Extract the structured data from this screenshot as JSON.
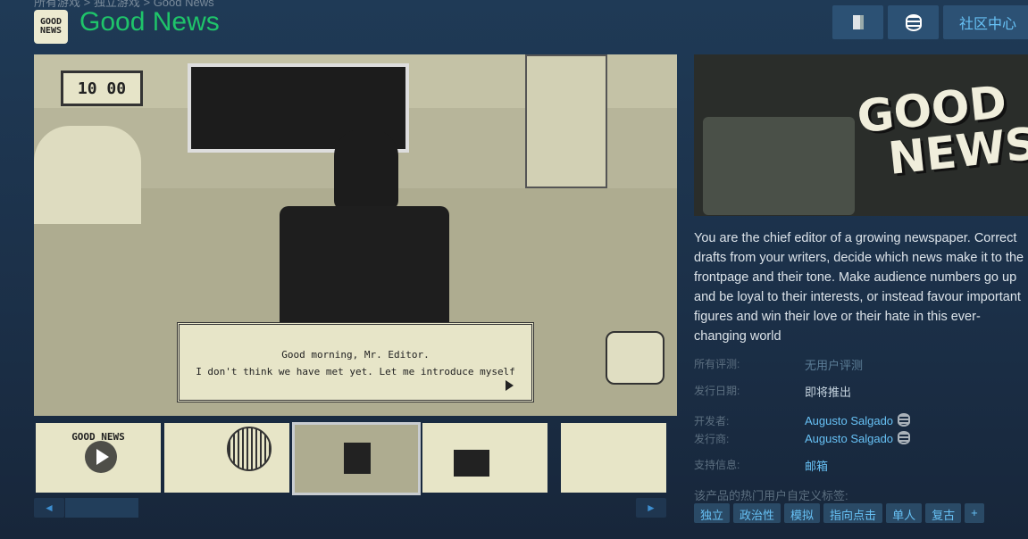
{
  "breadcrumb": [
    "所有游戏",
    "独立游戏",
    "Good News"
  ],
  "app": {
    "title": "Good News",
    "logo_text": "GOOD NEWS"
  },
  "header": {
    "community_hub": "社区中心",
    "icons": [
      "ignore-icon",
      "points-icon"
    ]
  },
  "screenshot": {
    "clock": "10 00",
    "dialogue_line1": "Good morning, Mr. Editor.",
    "dialogue_line2": "I don't think we have met yet. Let me introduce myself"
  },
  "thumbnails": [
    {
      "label": "GOOD NEWS",
      "type": "video"
    },
    {
      "type": "image"
    },
    {
      "type": "image",
      "selected": true
    },
    {
      "type": "image"
    },
    {
      "type": "image"
    }
  ],
  "capsule": {
    "line1": "GOOD",
    "line2": "NEWS"
  },
  "description": "You are the chief editor of a growing newspaper. Correct drafts from your writers, decide which news make it to the frontpage and their tone. Make audience numbers go up and be loyal to their interests, or instead favour important figures and win their love or their hate in this ever-changing world",
  "details": {
    "reviews_label": "所有评测:",
    "reviews_value": "无用户评测",
    "release_label": "发行日期:",
    "release_value": "即将推出",
    "developer_label": "开发者:",
    "developer_value": "Augusto Salgado",
    "publisher_label": "发行商:",
    "publisher_value": "Augusto Salgado",
    "support_label": "支持信息:",
    "support_value": "邮箱"
  },
  "tags": {
    "label": "该产品的热门用户自定义标签:",
    "items": [
      "独立",
      "政治性",
      "模拟",
      "指向点击",
      "单人",
      "复古",
      "+"
    ]
  },
  "nav": {
    "prev": "◄",
    "next": "►"
  }
}
